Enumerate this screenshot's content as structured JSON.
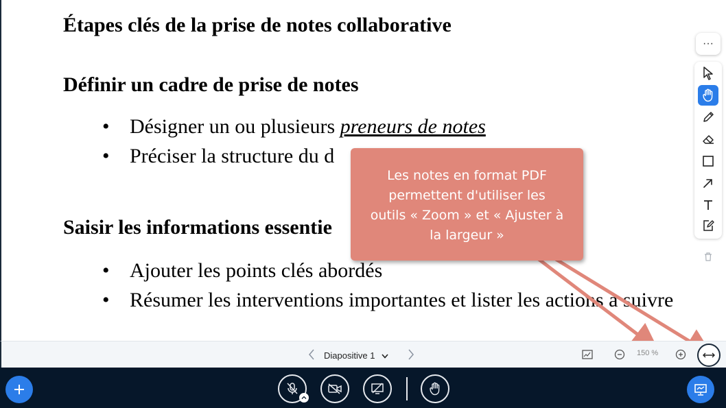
{
  "slide": {
    "title": "Étapes clés de la prise de notes collaborative",
    "section1": {
      "heading": "Définir un cadre de prise de notes",
      "bullets": [
        {
          "prefix": "Désigner un ou plusieurs ",
          "emphasis": "preneurs de notes"
        },
        {
          "text": "Préciser la structure du d"
        }
      ]
    },
    "section2": {
      "heading": "Saisir les informations essentie",
      "bullets": [
        {
          "text": "Ajouter les points clés abordés"
        },
        {
          "text": "Résumer les interventions importantes et lister les actions à suivre"
        }
      ]
    },
    "bullet_char": "•"
  },
  "callout": {
    "lines": [
      "Les notes en format PDF",
      "permettent d'utiliser les",
      "outils « Zoom » et « Ajuster à",
      "la largeur »"
    ],
    "color": "#e0877a"
  },
  "toolbar": {
    "more_label": "···",
    "tools": [
      "pointer-icon",
      "hand-icon",
      "pencil-icon",
      "eraser-icon",
      "rectangle-icon",
      "arrow-icon",
      "text-icon",
      "sticky-note-icon"
    ],
    "active_tool": "hand-icon",
    "trash": "trash-icon"
  },
  "presentation_bar": {
    "slide_label": "Diapositive 1",
    "zoom_level": "150 %"
  },
  "action_bar": {
    "buttons": [
      "plus-icon",
      "microphone-muted-icon",
      "camera-off-icon",
      "screenshare-off-icon",
      "raise-hand-icon",
      "presentation-icon"
    ]
  },
  "colors": {
    "accent": "#2b7de9",
    "action_bar_bg": "#06172a",
    "presentation_bar_bg": "#f3f6f9"
  }
}
